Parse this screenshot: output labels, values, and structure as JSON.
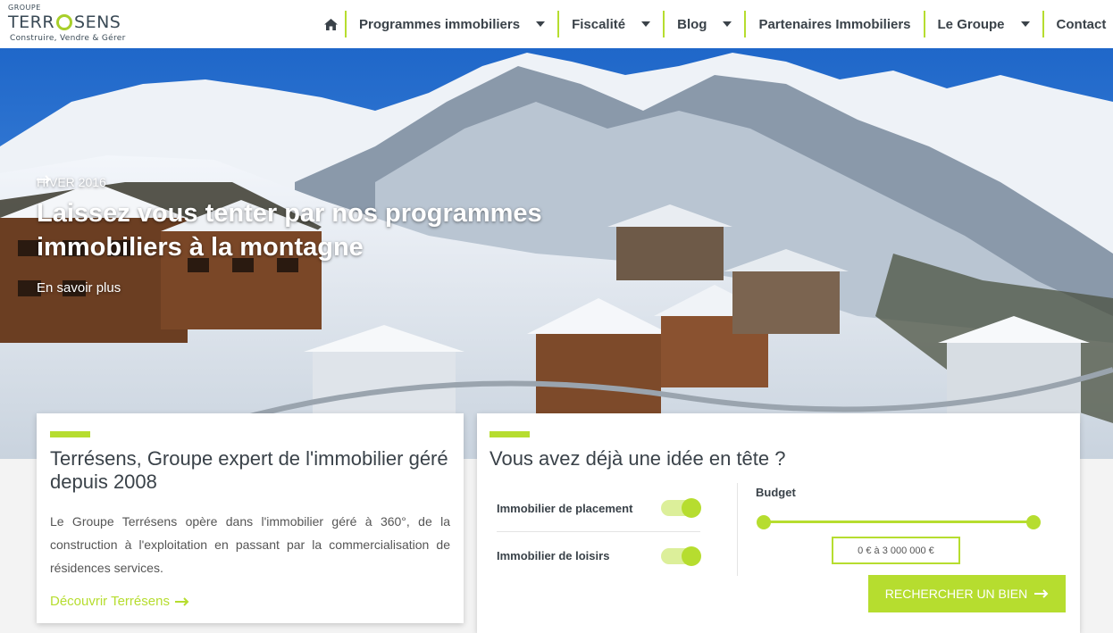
{
  "logo": {
    "small": "GROUPE",
    "brand_left": "TERR",
    "brand_right": "SENS",
    "tagline": "Construire, Vendre & Gérer"
  },
  "nav": {
    "home_icon": "home-icon",
    "items": [
      {
        "label": "Programmes immobiliers",
        "has_dropdown": true
      },
      {
        "label": "Fiscalité",
        "has_dropdown": true
      },
      {
        "label": "Blog",
        "has_dropdown": true
      },
      {
        "label": "Partenaires Immobiliers",
        "has_dropdown": false
      },
      {
        "label": "Le Groupe",
        "has_dropdown": true
      },
      {
        "label": "Contact",
        "has_dropdown": false
      }
    ]
  },
  "hero": {
    "kicker": "HIVER 2016",
    "title": "Laissez vous tenter par nos programmes immobiliers à la montagne",
    "link": "En savoir plus"
  },
  "about": {
    "title": "Terrésens, Groupe expert de l'immobilier géré depuis 2008",
    "text": "Le Groupe Terrésens opère dans l'immobilier géré à 360°, de la construction à l'exploitation en passant par la commercialisation de résidences services.",
    "link": "Découvrir Terrésens"
  },
  "search": {
    "title": "Vous avez déjà une idée en tête ?",
    "options": [
      {
        "label": "Immobilier de placement",
        "checked": true
      },
      {
        "label": "Immobilier de loisirs",
        "checked": true
      }
    ],
    "budget_label": "Budget",
    "budget_range": "0 € à 3 000 000 €",
    "button": "RECHERCHER UN BIEN"
  },
  "colors": {
    "accent": "#b6dd2f",
    "text_dark": "#3a4249"
  }
}
